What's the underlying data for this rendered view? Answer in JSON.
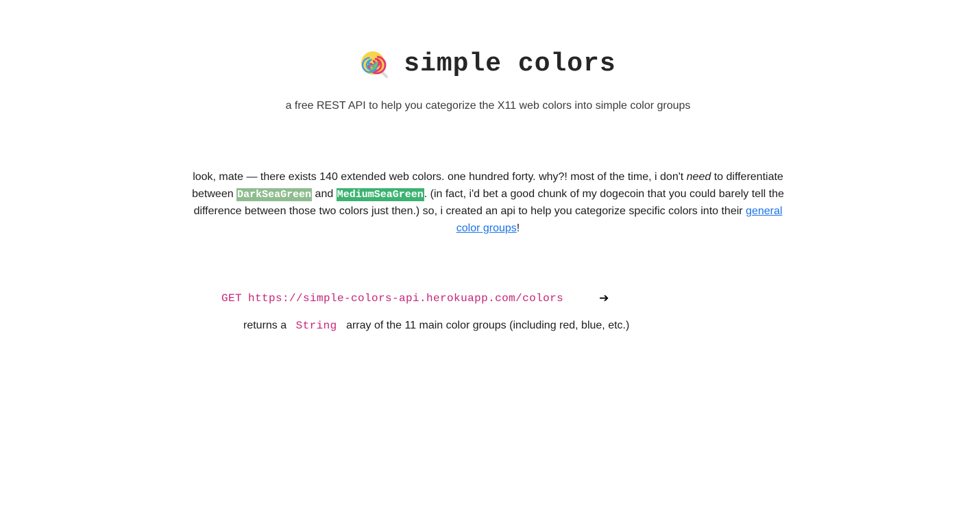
{
  "header": {
    "icon": "lollipop-icon",
    "title": "simple colors",
    "subtitle": "a free REST API to help you categorize the X11 web colors into simple color groups"
  },
  "intro": {
    "part1": "look, mate — there exists 140 extended web colors. one hundred forty. why?! most of the time, i don't ",
    "emphasis": "need",
    "part2": " to differentiate between ",
    "color_a": {
      "name": "DarkSeaGreen",
      "hex": "#8fbc8f"
    },
    "and_text": " and ",
    "color_b": {
      "name": "MediumSeaGreen",
      "hex": "#3cb371"
    },
    "part3": ". (in fact, i'd bet a good chunk of my dogecoin that you could barely tell the difference between those two colors just then.) so, i created an api to help you categorize specific colors into their ",
    "link_text": "general color groups",
    "end": "!"
  },
  "endpoint": {
    "method": "GET",
    "url": "https://simple-colors-api.herokuapp.com/colors",
    "arrow": "➔",
    "desc_before": "returns a",
    "desc_type": "String",
    "desc_after": "array of the 11 main color groups (including red, blue, etc.)"
  },
  "colors": {
    "code": "#c6247a",
    "link": "#1a73e8"
  }
}
